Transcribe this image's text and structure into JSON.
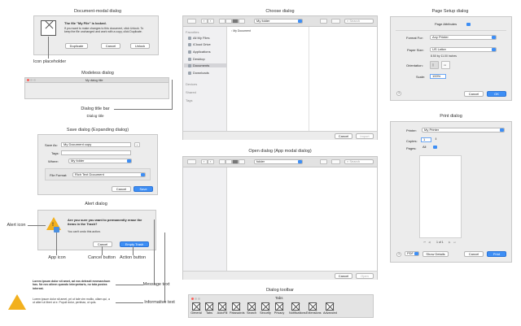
{
  "document_modal": {
    "caption": "Document-modal dialog",
    "title": "The file \"My File\" is locked.",
    "body": "If you want to make changes to this document, click Unlock. To keep the file unchanged and work with a copy, click Duplicate.",
    "buttons": [
      "Duplicate",
      "Cancel",
      "Unlock"
    ],
    "icon_callout": "Icon placeholder"
  },
  "modeless": {
    "caption": "Modeless dialog",
    "window_title": "My dialog title",
    "callout": "Dialog title bar",
    "callout_sub": "Dialog title"
  },
  "save_dialog": {
    "caption": "Save dialog (Expanding dialog)",
    "save_as_label": "Save As:",
    "save_as_value": "My Document copy",
    "tags_label": "Tags:",
    "where_label": "Where:",
    "where_value": "My folder",
    "format_label": "File Format:",
    "format_value": "Rich Text Document",
    "buttons": [
      "Cancel",
      "Save"
    ]
  },
  "alert": {
    "caption": "Alert dialog",
    "title": "Are you sure you want to permanently erase the items in the Trash?",
    "body": "You can't undo this action.",
    "buttons": [
      "Cancel",
      "Empty Trash"
    ],
    "callouts": {
      "alert_icon": "Alert icon",
      "app_icon": "App icon",
      "cancel_button": "Cancel button",
      "action_button": "Action button",
      "message_text": "Message text",
      "informative_text": "Informative text"
    },
    "sample_message": "Lorem ipsum dolor sit amet, ad eos detraxit mnesarchum has. Ne nec alteen quando interpretaris, no tota postea intereat.",
    "sample_informative": "Lorem ipsum dolor sit amet, pri ut tale vim mollio, ullam qui, a ut alteri ut liberi ut e. Populi dolor, pertinax, ut quis."
  },
  "choose_dialog": {
    "caption": "Choose dialog",
    "path": "My folder",
    "search_placeholder": "Search",
    "sidebar_heading": "Favorites",
    "sidebar_items": [
      "All My Files",
      "iCloud Drive",
      "Applications",
      "Desktop",
      "Documents",
      "Downloads"
    ],
    "devices_heading": "Devices",
    "shared_heading": "Shared",
    "tags_heading": "Tags",
    "file_item": "My Document",
    "buttons": [
      "Cancel",
      "Import"
    ]
  },
  "open_dialog": {
    "caption": "Open dialog (App modal dialog)",
    "path": "folder",
    "search_placeholder": "Search",
    "buttons": [
      "Cancel",
      "Open"
    ]
  },
  "toolbar_dialog": {
    "caption": "Dialog toolbar",
    "title": "Tabs",
    "items": [
      "General",
      "Tabs",
      "AutoFill",
      "Passwords",
      "Search",
      "Security",
      "Privacy",
      "Notifications",
      "Extensions",
      "Advanced"
    ]
  },
  "page_setup": {
    "caption": "Page Setup dialog",
    "settings_value": "Page Attributes",
    "format_label": "Format For:",
    "format_value": "Any Printer",
    "paper_label": "Paper Size:",
    "paper_value": "US Letter",
    "paper_dims": "8.50 by 11.00 inches",
    "orientation_label": "Orientation:",
    "scale_label": "Scale:",
    "scale_value": "100%",
    "help": "?",
    "buttons": [
      "Cancel",
      "OK"
    ]
  },
  "print_dialog": {
    "caption": "Print dialog",
    "printer_label": "Printer:",
    "printer_value": "My Printer",
    "copies_label": "Copies:",
    "copies_value": "1",
    "pages_label": "Pages:",
    "pages_value": "All",
    "page_counter": "1 of 1",
    "help": "?",
    "pdf_label": "PDF",
    "buttons": [
      "Show Details",
      "Cancel",
      "Print"
    ]
  }
}
